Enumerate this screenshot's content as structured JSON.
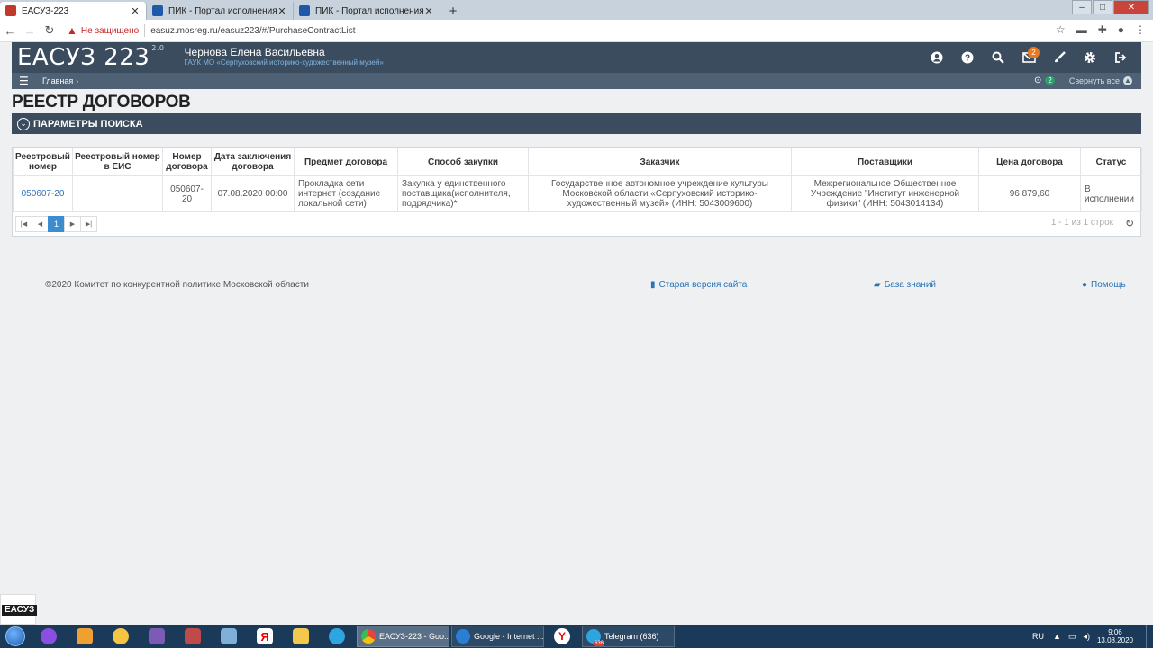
{
  "browser": {
    "tabs": [
      {
        "title": "ЕАСУЗ-223",
        "favicon_color": "#c0392b",
        "active": true
      },
      {
        "title": "ПИК - Портал исполнения конт",
        "favicon_color": "#1e5aa8",
        "active": false
      },
      {
        "title": "ПИК - Портал исполнения конт",
        "favicon_color": "#1e5aa8",
        "active": false
      }
    ],
    "new_tab": "+",
    "security": "Не защищено",
    "url": "easuz.mosreg.ru/easuz223/#/PurchaseContractList",
    "nav": {
      "back": "←",
      "forward": "→",
      "reload": "↻"
    },
    "actions": {
      "star": "☆",
      "ext1": "▬",
      "ext2": "✚",
      "profile": "●",
      "menu": "⋮"
    },
    "window": {
      "minimize": "–",
      "maximize": "□",
      "close": "✕"
    }
  },
  "app": {
    "logo": "ЕАСУЗ 223",
    "logo_version": "2.0",
    "user_name": "Чернова Елена Васильевна",
    "user_org": "ГАУК МО «Серпуховский историко-художественный музей»",
    "icons": [
      "user-icon",
      "help-icon",
      "search-icon",
      "mail-icon",
      "brush-icon",
      "gear-icon",
      "logout-icon"
    ],
    "mail_badge": "2",
    "breadcrumb": "Главная",
    "breadcrumb_arrow": "›",
    "notifications_count": "2",
    "collapse_all": "Свернуть все"
  },
  "page": {
    "title": "РЕЕСТР ДОГОВОРОВ",
    "search_panel": "ПАРАМЕТРЫ ПОИСКА"
  },
  "table": {
    "columns": [
      "Реестровый номер",
      "Реестровый номер в ЕИС",
      "Номер договора",
      "Дата заключения договора",
      "Предмет договора",
      "Способ закупки",
      "Заказчик",
      "Поставщики",
      "Цена договора",
      "Статус"
    ],
    "rows": [
      {
        "reg_number": "050607-20",
        "eis_number": "",
        "contract_number": "050607-20",
        "date": "07.08.2020 00:00",
        "subject": "Прокладка сети интернет (создание локальной сети)",
        "method": "Закупка у единственного поставщика(исполнителя, подрядчика)*",
        "customer": "Государственное автономное учреждение культуры Московской области «Серпуховский историко-художественный музей» (ИНН: 5043009600)",
        "supplier": "Межрегиональное Общественное Учреждение \"Институт инженерной физики\" (ИНН: 5043014134)",
        "price": "96 879,60",
        "status": "В исполнении"
      }
    ],
    "pager": {
      "first": "|◀",
      "prev": "◀",
      "page": "1",
      "next": "▶",
      "last": "▶|",
      "info": "1 - 1 из 1 строк"
    }
  },
  "footer": {
    "copyright": "©2020 Комитет по конкурентной политике Московской области",
    "old_version": "Старая версия сайта",
    "knowledge_base": "База знаний",
    "help": "Помощь"
  },
  "corner_tag": "ЕАСУЗ",
  "taskbar": {
    "windows": [
      {
        "title": "ЕАСУЗ-223 - Goo...",
        "color": "#e8443a",
        "active": true
      },
      {
        "title": "Google - Internet ...",
        "color": "#2a7fd4",
        "active": false
      },
      {
        "title": "Telegram (636)",
        "color": "#2ca5e0",
        "active": false
      }
    ],
    "telegram_badge": "636",
    "lang": "RU",
    "time": "9:06",
    "date": "13.08.2020"
  }
}
